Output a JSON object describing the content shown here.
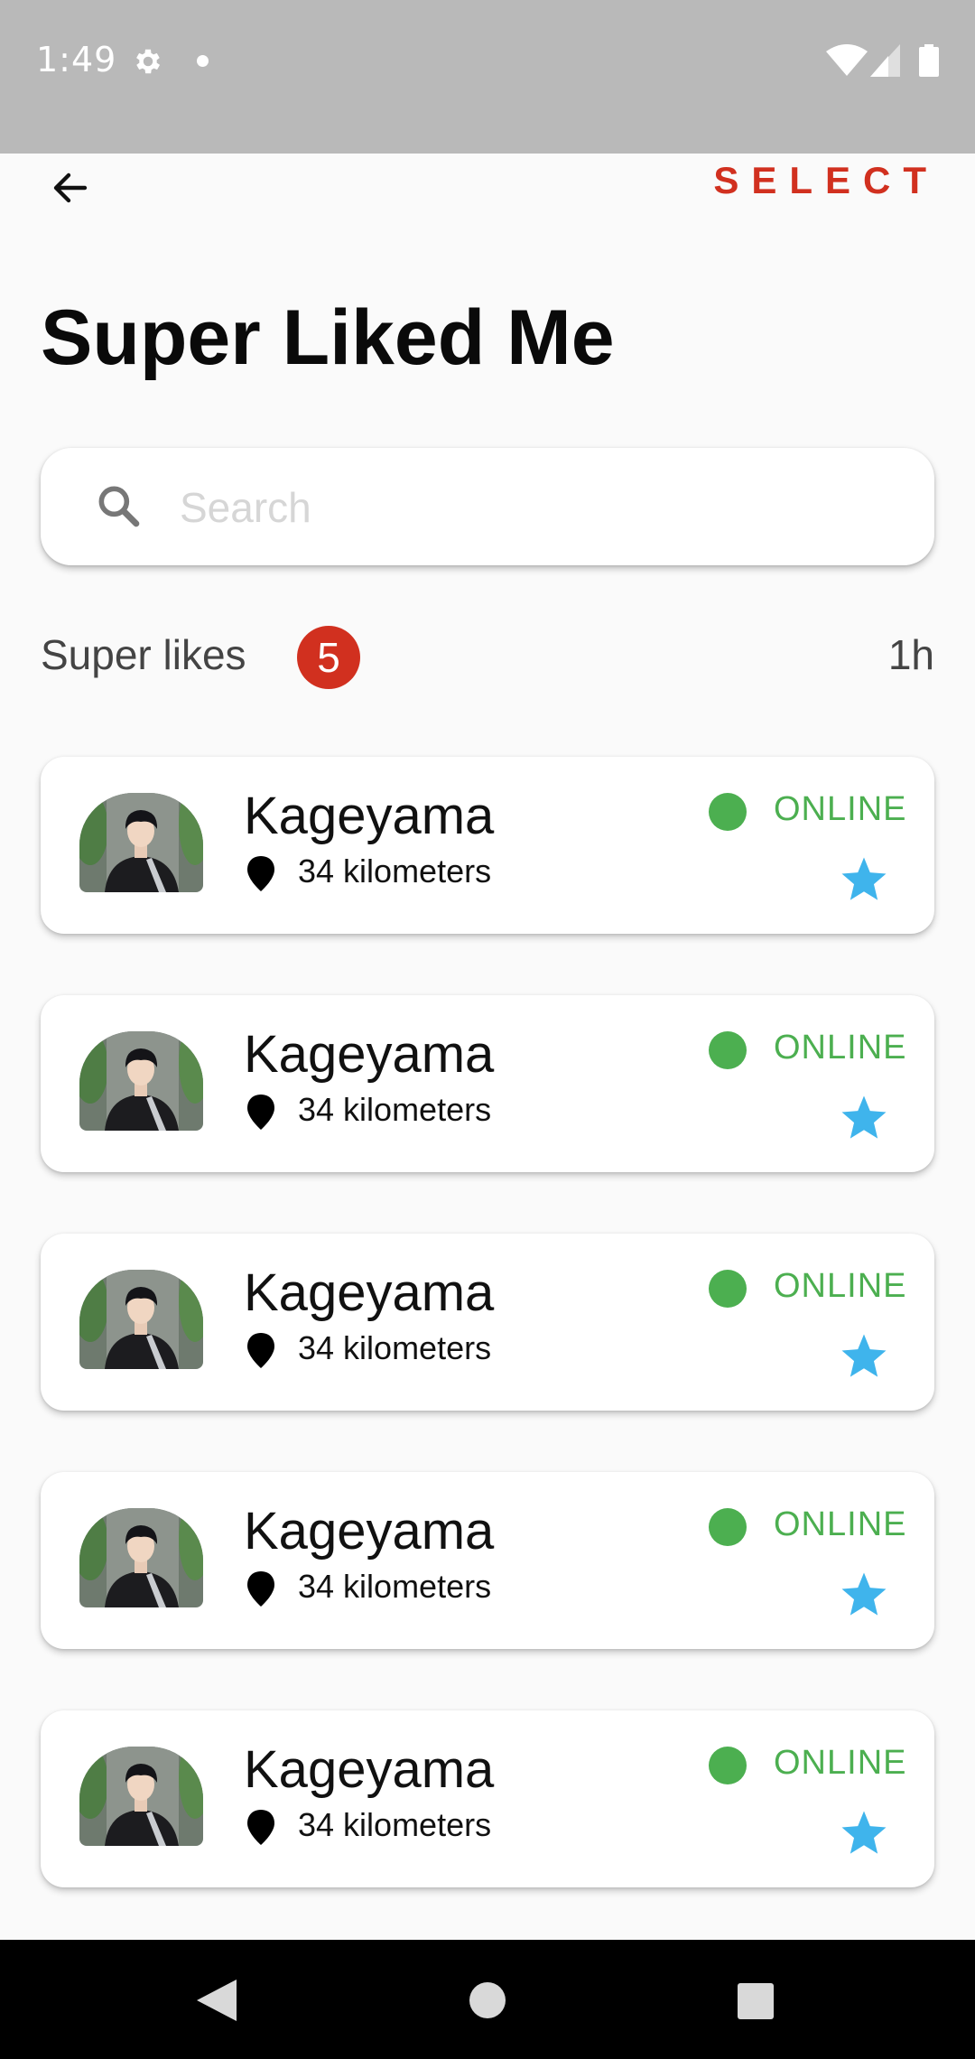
{
  "status_bar": {
    "time": "1:49",
    "icons": [
      "gear-icon",
      "notification-dot-icon",
      "wifi-icon",
      "signal-icon",
      "battery-icon"
    ]
  },
  "app_bar": {
    "back_icon": "arrow-left-icon",
    "select_label": "SELECT"
  },
  "page": {
    "title": "Super Liked Me"
  },
  "search": {
    "placeholder": "Search",
    "value": ""
  },
  "section": {
    "label": "Super likes",
    "count": "5",
    "time": "1h"
  },
  "cards": [
    {
      "name": "Kageyama",
      "distance": "34 kilometers",
      "status": "ONLINE"
    },
    {
      "name": "Kageyama",
      "distance": "34 kilometers",
      "status": "ONLINE"
    },
    {
      "name": "Kageyama",
      "distance": "34 kilometers",
      "status": "ONLINE"
    },
    {
      "name": "Kageyama",
      "distance": "34 kilometers",
      "status": "ONLINE"
    },
    {
      "name": "Kageyama",
      "distance": "34 kilometers",
      "status": "ONLINE"
    }
  ],
  "colors": {
    "accent_red": "#d1301f",
    "online_green": "#4caf50",
    "star_blue": "#3fb4ec",
    "status_bar_gray": "#b9b9b9"
  },
  "nav_bar": {
    "icons": [
      "nav-back-icon",
      "nav-home-icon",
      "nav-recents-icon"
    ]
  }
}
